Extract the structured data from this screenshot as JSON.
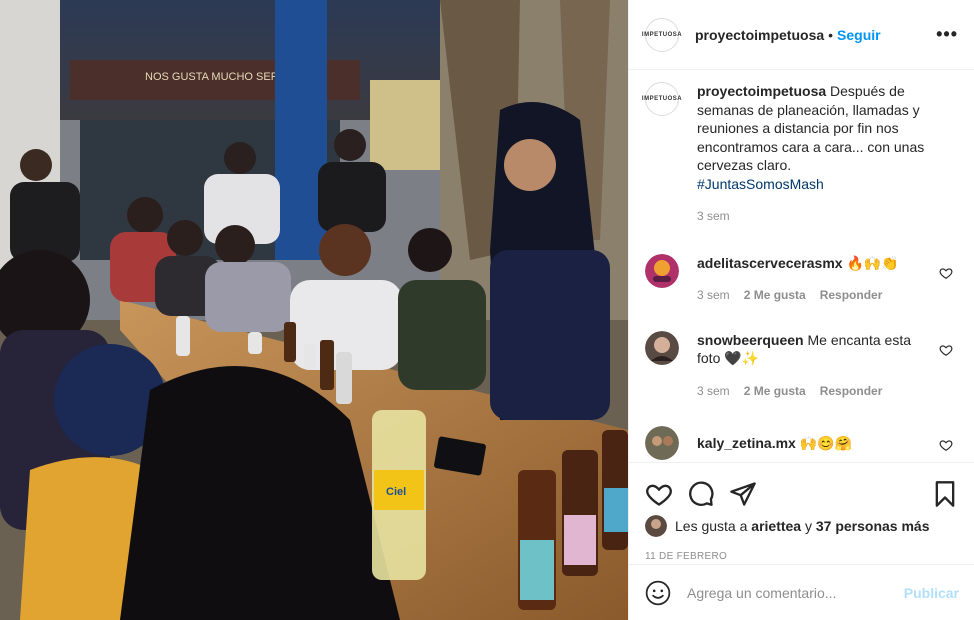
{
  "post": {
    "account": {
      "username": "proyectoimpetuosa",
      "logo_text": "IMPETUOSA",
      "separator": "•",
      "follow_label": "Seguir",
      "more_label": "•••"
    },
    "caption": {
      "username": "proyectoimpetuosa",
      "text": "Después de semanas de planeación, llamadas y reuniones a distancia por fin nos encontramos cara a cara... con unas cervezas claro.",
      "hashtag": "#JuntasSomosMash",
      "time": "3 sem"
    },
    "comments": [
      {
        "username": "adelitascervecerasmx",
        "text": "🔥🙌👏",
        "time": "3 sem",
        "likes": "2 Me gusta",
        "reply_label": "Responder",
        "avatar_color": "#b0306a"
      },
      {
        "username": "snowbeerqueen",
        "text": "Me encanta esta foto 🖤✨",
        "time": "3 sem",
        "likes": "2 Me gusta",
        "reply_label": "Responder",
        "avatar_color": "#5a4a44"
      },
      {
        "username": "kaly_zetina.mx",
        "text": "🙌😊🤗",
        "avatar_color": "#6e6a55"
      }
    ],
    "likes": {
      "prefix": "Les gusta a",
      "user": "ariettea",
      "connector": "y",
      "others": "37 personas más"
    },
    "date": "11 DE FEBRERO",
    "comment_box": {
      "placeholder": "Agrega un comentario...",
      "publish_label": "Publicar"
    },
    "photo": {
      "sign_text": "NOS GUSTA MUCHO SER",
      "bottle_label": "Ciel"
    },
    "colors": {
      "link_blue": "#0095f6",
      "publish_disabled": "#b2dffc",
      "hashtag": "#00376b",
      "muted": "#8e8e8e"
    }
  }
}
